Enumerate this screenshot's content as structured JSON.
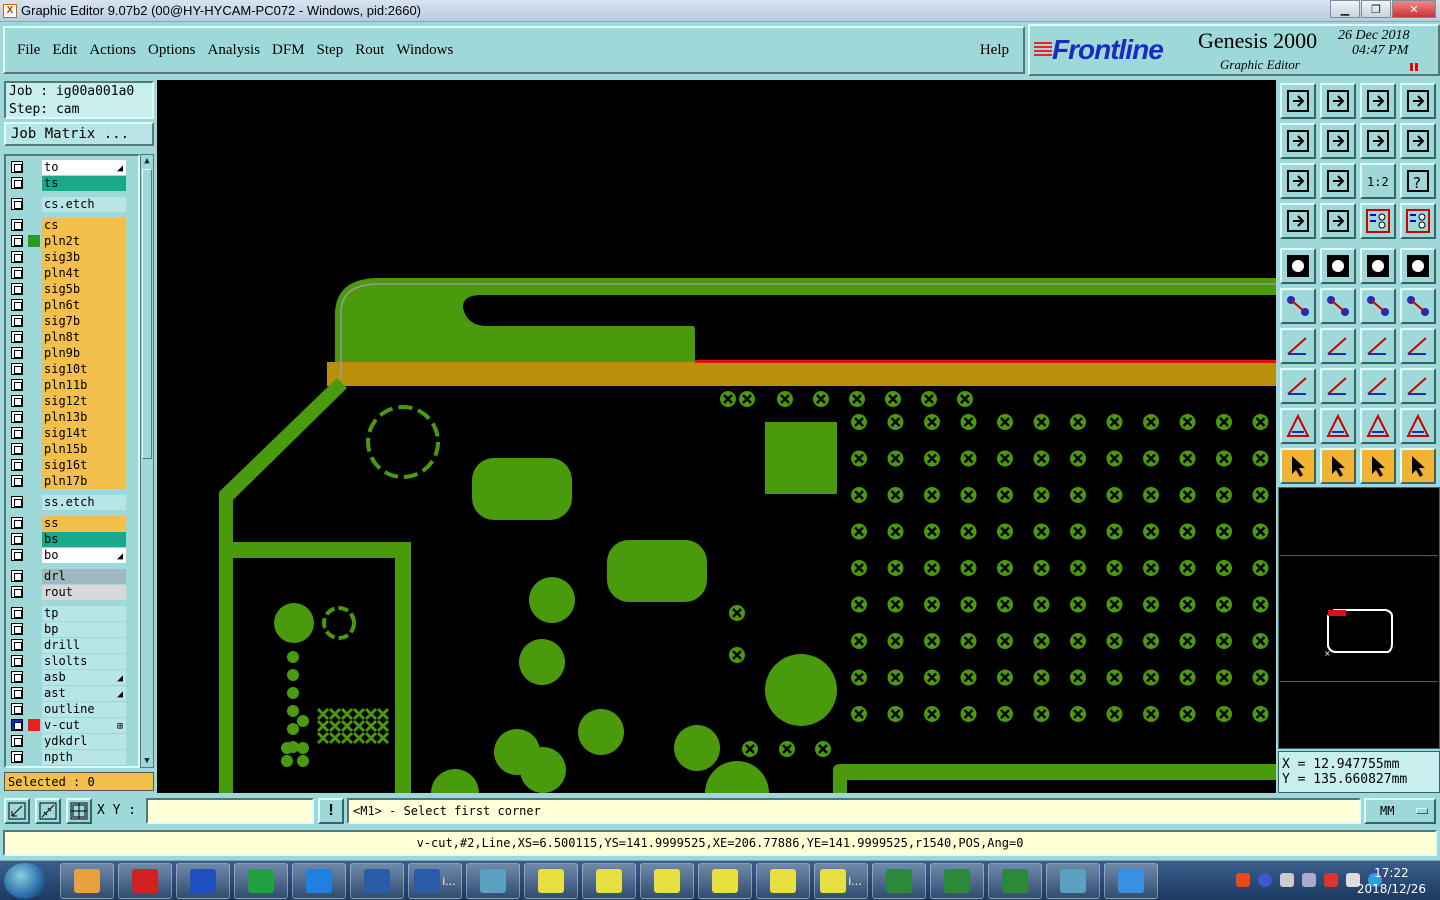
{
  "window": {
    "title": "Graphic Editor 9.07b2 (00@HY-HYCAM-PC072 - Windows, pid:2660)",
    "app_icon": "X"
  },
  "menu": {
    "items": [
      "File",
      "Edit",
      "Actions",
      "Options",
      "Analysis",
      "DFM",
      "Step",
      "Rout",
      "Windows"
    ],
    "help": "Help"
  },
  "brand": {
    "logo": "Frontline",
    "product": "Genesis 2000",
    "subtitle": "Graphic Editor",
    "date": "26 Dec 2018",
    "time": "04:47  PM"
  },
  "job": {
    "job_line": "Job : ig00a001a0",
    "step_line": "Step: cam",
    "matrix_button": "Job Matrix ..."
  },
  "layers": [
    {
      "name": "to",
      "color": "#ffffff",
      "mark": "◢"
    },
    {
      "name": "ts",
      "color": "#1aa88a",
      "mark": ""
    },
    {
      "name": "cs.etch",
      "color": "#b8e6e6",
      "mark": "",
      "gap": true
    },
    {
      "name": "cs",
      "color": "#f2c04a",
      "mark": "",
      "gap": true
    },
    {
      "name": "pln2t",
      "color": "#f2c04a",
      "mark": "",
      "swatch": "#2c9a1a"
    },
    {
      "name": "sig3b",
      "color": "#f2c04a",
      "mark": ""
    },
    {
      "name": "pln4t",
      "color": "#f2c04a",
      "mark": ""
    },
    {
      "name": "sig5b",
      "color": "#f2c04a",
      "mark": ""
    },
    {
      "name": "pln6t",
      "color": "#f2c04a",
      "mark": ""
    },
    {
      "name": "sig7b",
      "color": "#f2c04a",
      "mark": ""
    },
    {
      "name": "pln8t",
      "color": "#f2c04a",
      "mark": ""
    },
    {
      "name": "pln9b",
      "color": "#f2c04a",
      "mark": ""
    },
    {
      "name": "sig10t",
      "color": "#f2c04a",
      "mark": ""
    },
    {
      "name": "pln11b",
      "color": "#f2c04a",
      "mark": ""
    },
    {
      "name": "sig12t",
      "color": "#f2c04a",
      "mark": ""
    },
    {
      "name": "pln13b",
      "color": "#f2c04a",
      "mark": ""
    },
    {
      "name": "sig14t",
      "color": "#f2c04a",
      "mark": ""
    },
    {
      "name": "pln15b",
      "color": "#f2c04a",
      "mark": ""
    },
    {
      "name": "sig16t",
      "color": "#f2c04a",
      "mark": ""
    },
    {
      "name": "pln17b",
      "color": "#f2c04a",
      "mark": ""
    },
    {
      "name": "ss.etch",
      "color": "#b8e6e6",
      "mark": "",
      "gap": true
    },
    {
      "name": "ss",
      "color": "#f2c04a",
      "mark": "",
      "gap": true
    },
    {
      "name": "bs",
      "color": "#1aa88a",
      "mark": ""
    },
    {
      "name": "bo",
      "color": "#ffffff",
      "mark": "◢"
    },
    {
      "name": "drl",
      "color": "#a0b8c0",
      "mark": "",
      "gap": true
    },
    {
      "name": "rout",
      "color": "#d8d8d8",
      "mark": ""
    },
    {
      "name": "tp",
      "color": "#b8e6e6",
      "mark": "",
      "gap": true
    },
    {
      "name": "bp",
      "color": "#b8e6e6",
      "mark": ""
    },
    {
      "name": "drill",
      "color": "#b8e6e6",
      "mark": ""
    },
    {
      "name": "slolts",
      "color": "#b8e6e6",
      "mark": ""
    },
    {
      "name": "asb",
      "color": "#b8e6e6",
      "mark": "◢"
    },
    {
      "name": "ast",
      "color": "#b8e6e6",
      "mark": "◢"
    },
    {
      "name": "outline",
      "color": "#b8e6e6",
      "mark": ""
    },
    {
      "name": "v-cut",
      "color": "#b8e6e6",
      "mark": "⊞",
      "swatch": "#e82020",
      "active": true
    },
    {
      "name": "ydkdrl",
      "color": "#b8e6e6",
      "mark": ""
    },
    {
      "name": "npth",
      "color": "#b8e6e6",
      "mark": ""
    }
  ],
  "selected": "Selected : 0",
  "coords": {
    "x": "X  = 12.947755mm",
    "y": "Y  = 135.660827mm"
  },
  "xy_label": "X Y :",
  "xy_value": "",
  "warn_label": "!",
  "prompt": "<M1> - Select first corner",
  "units": "MM",
  "status": "v-cut,#2,Line,XS=6.500115,YS=141.9999525,XE=206.77886,YE=141.9999525,r1540,POS,Ang=0",
  "tool_labels": {
    "scale": "1:2",
    "help": "?"
  },
  "taskbar": {
    "items": [
      {
        "icon": "shell-icon",
        "label": ""
      },
      {
        "icon": "g-icon",
        "label": ""
      },
      {
        "icon": "save-icon",
        "label": ""
      },
      {
        "icon": "f-icon",
        "label": ""
      },
      {
        "icon": "ie-icon",
        "label": ""
      },
      {
        "icon": "word-icon",
        "label": ""
      },
      {
        "icon": "word-icon",
        "label": "i..."
      },
      {
        "icon": "eye-icon",
        "label": ""
      },
      {
        "icon": "genesis-icon",
        "label": ""
      },
      {
        "icon": "genesis-icon",
        "label": ""
      },
      {
        "icon": "genesis-icon",
        "label": ""
      },
      {
        "icon": "genesis-icon",
        "label": ""
      },
      {
        "icon": "genesis-icon",
        "label": ""
      },
      {
        "icon": "genesis-icon",
        "label": "i..."
      },
      {
        "icon": "excel-icon",
        "label": ""
      },
      {
        "icon": "excel-icon",
        "label": ""
      },
      {
        "icon": "excel-icon",
        "label": ""
      },
      {
        "icon": "eye-icon",
        "label": ""
      },
      {
        "icon": "bird-icon",
        "label": ""
      }
    ],
    "clock_time": "17:22",
    "clock_date": "2018/12/26"
  },
  "colors": {
    "copper": "#4a9a0e",
    "outline_gold": "#b8900a",
    "vcut_red": "#e01010",
    "panel": "#9fd8d8"
  }
}
